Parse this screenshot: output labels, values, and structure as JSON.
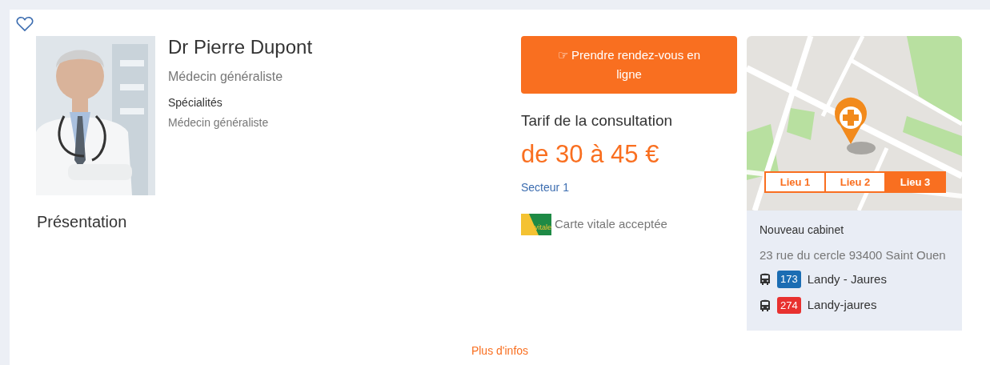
{
  "favorite": {
    "selected": false
  },
  "doctor": {
    "name": "Dr Pierre Dupont",
    "profession": "Médecin généraliste",
    "specialties_label": "Spécialités",
    "specialties": "Médecin généraliste"
  },
  "presentation_title": "Présentation",
  "booking": {
    "icon": "☞",
    "label": "Prendre rendez-vous en ligne"
  },
  "fee": {
    "title": "Tarif de la consultation",
    "amount": "de 30 à 45 €",
    "sector": "Secteur 1"
  },
  "vitale": {
    "badge": "vitale",
    "text": "Carte vitale acceptée"
  },
  "locations": [
    {
      "label": "Lieu 1",
      "selected": false
    },
    {
      "label": "Lieu 2",
      "selected": false
    },
    {
      "label": "Lieu 3",
      "selected": true
    }
  ],
  "place": {
    "name": "Nouveau cabinet",
    "address": "23 rue du cercle 93400 Saint Ouen"
  },
  "transport": [
    {
      "line": "173",
      "stop": "Landy - Jaures",
      "color": "#1b6db3"
    },
    {
      "line": "274",
      "stop": "Landy-jaures",
      "color": "#e8312f"
    }
  ],
  "more_link": "Plus d'infos"
}
